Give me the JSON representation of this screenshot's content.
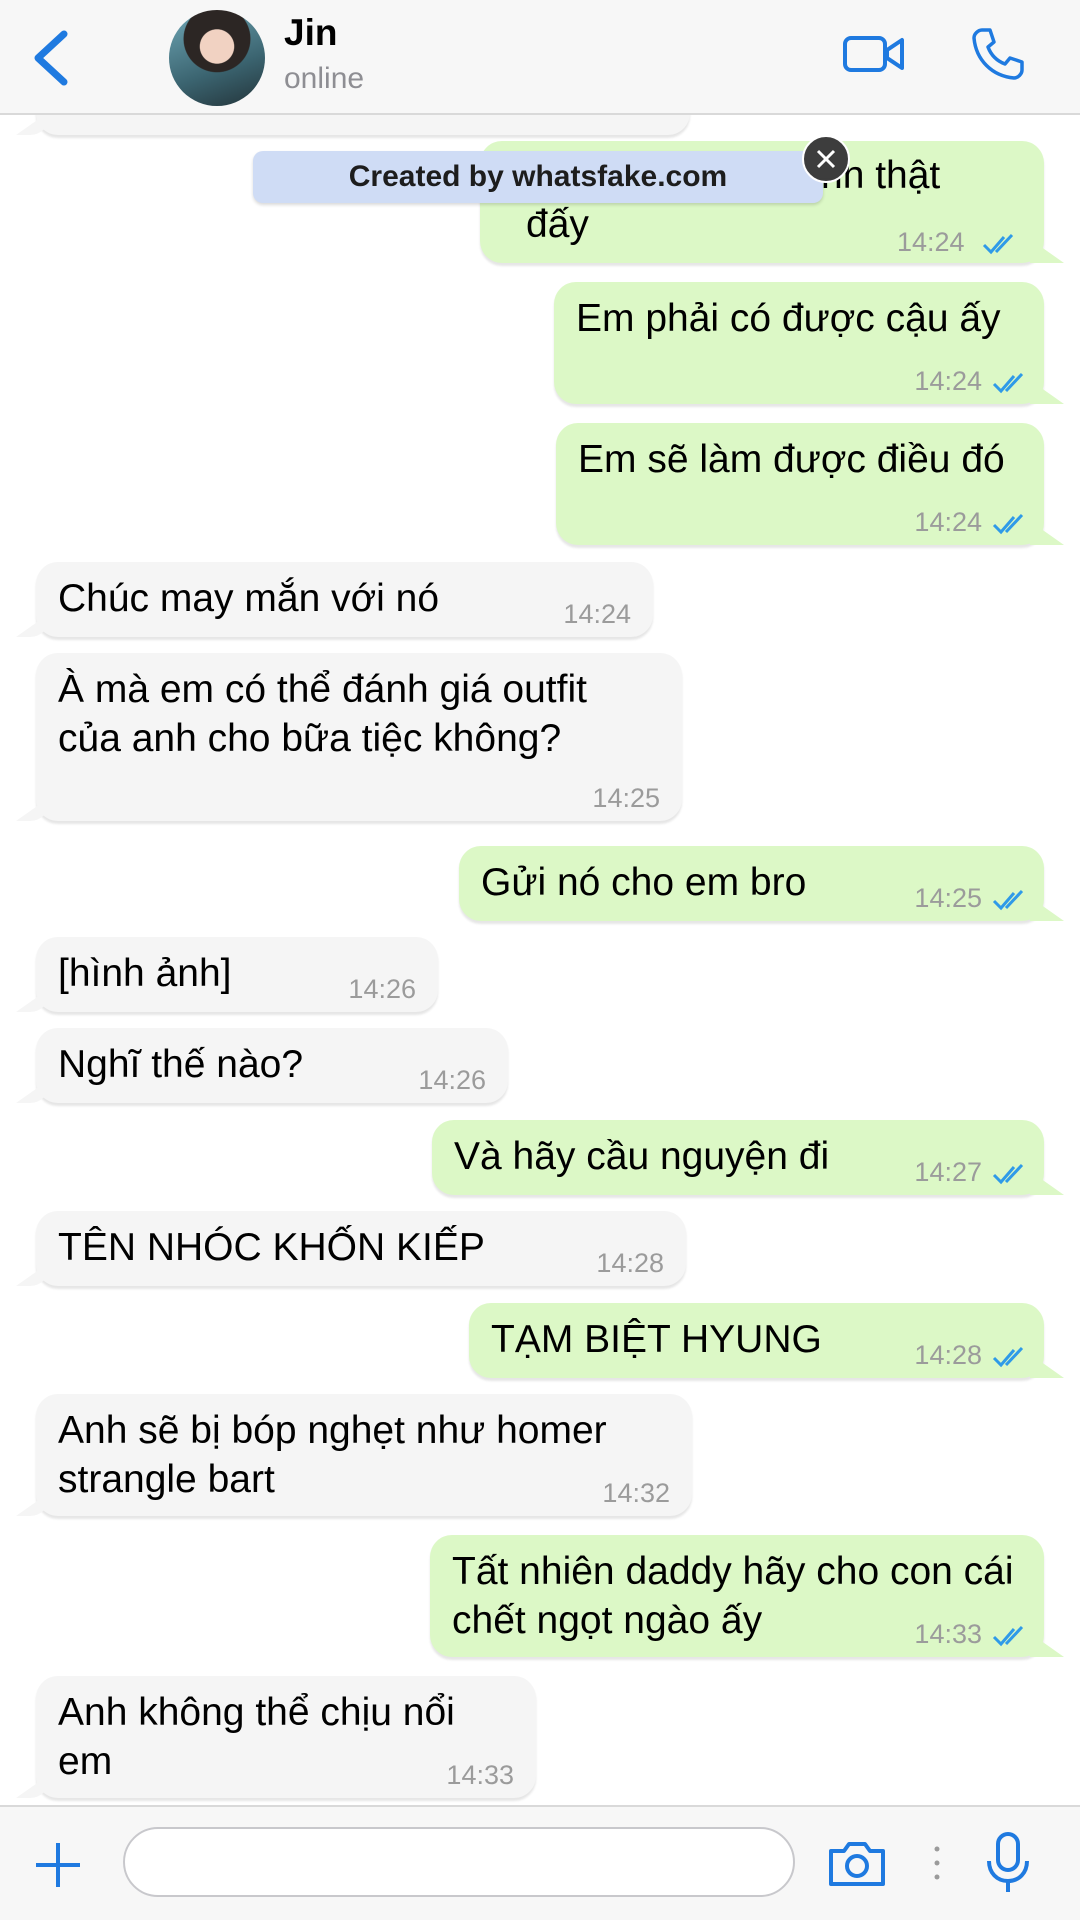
{
  "header": {
    "name": "Jin",
    "status": "online"
  },
  "watermark": "Created by whatsfake.com",
  "messages": [
    {
      "side": "out",
      "text": "nh thật đấy",
      "time": "14:24"
    },
    {
      "side": "out",
      "text": "Em phải có được cậu ấy",
      "time": "14:24"
    },
    {
      "side": "out",
      "text": "Em sẽ làm được điều đó",
      "time": "14:24"
    },
    {
      "side": "in",
      "text": "Chúc may mắn với nó",
      "time": "14:24"
    },
    {
      "side": "in",
      "text": "À mà em có thể đánh giá outfit của anh cho bữa tiệc không?",
      "time": "14:25"
    },
    {
      "side": "out",
      "text": "Gửi nó cho em bro",
      "time": "14:25"
    },
    {
      "side": "in",
      "text": "[hình ảnh]",
      "time": "14:26"
    },
    {
      "side": "in",
      "text": "Nghĩ thế nào?",
      "time": "14:26"
    },
    {
      "side": "out",
      "text": "Và hãy cầu nguyện đi",
      "time": "14:27"
    },
    {
      "side": "in",
      "text": "TÊN NHÓC KHỐN KIẾP",
      "time": "14:28"
    },
    {
      "side": "out",
      "text": "TẠM BIỆT HYUNG",
      "time": "14:28"
    },
    {
      "side": "in",
      "text": "Anh sẽ bị bóp nghẹt như homer strangle bart",
      "time": "14:32"
    },
    {
      "side": "out",
      "text": "Tất nhiên daddy hãy cho con cái chết ngọt ngào ấy",
      "time": "14:33"
    },
    {
      "side": "in",
      "text": "Anh không thể chịu nổi em",
      "time": "14:33"
    }
  ],
  "input": {
    "value": "",
    "placeholder": ""
  },
  "colors": {
    "accent": "#1f7ae0",
    "outgoing_bubble": "#dcf8c6",
    "incoming_bubble": "#f5f5f5",
    "read_ticks": "#2f9ae8"
  },
  "icons": [
    "back-icon",
    "video-call-icon",
    "phone-icon",
    "close-icon",
    "plus-icon",
    "camera-icon",
    "microphone-icon",
    "double-check-icon"
  ]
}
